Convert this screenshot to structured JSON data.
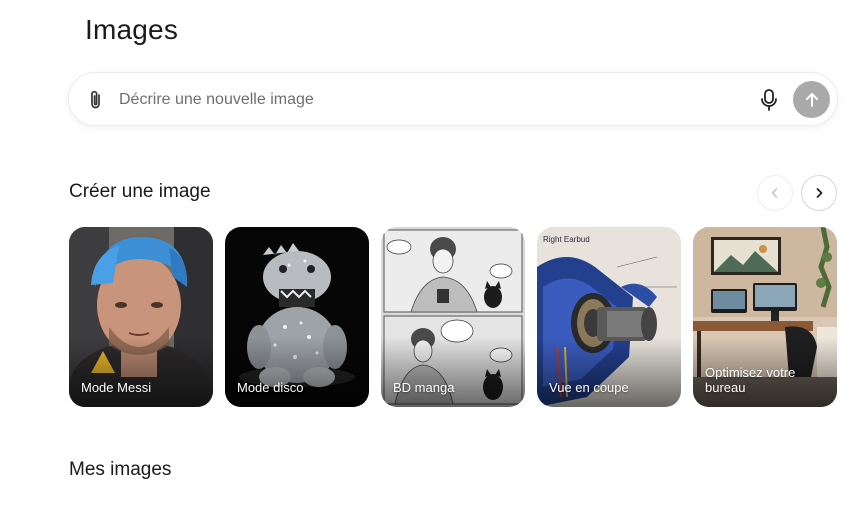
{
  "page": {
    "title": "Images"
  },
  "prompt": {
    "placeholder": "Décrire une nouvelle image",
    "value": "",
    "attach_icon": "paperclip-icon",
    "mic_icon": "microphone-icon",
    "send_icon": "arrow-up-icon"
  },
  "create_section": {
    "title": "Créer une image",
    "prev_icon": "chevron-left-icon",
    "next_icon": "chevron-right-icon",
    "cards": [
      {
        "label": "Mode Messi"
      },
      {
        "label": "Mode disco"
      },
      {
        "label": "BD manga"
      },
      {
        "label": "Vue en coupe",
        "tag": "Right Earbud"
      },
      {
        "label": "Optimisez votre bureau"
      }
    ]
  },
  "my_images": {
    "title": "Mes images"
  },
  "colors": {
    "send_button": "#a9a9a9",
    "text": "#1a1a1a",
    "placeholder": "#6f6f6f"
  }
}
